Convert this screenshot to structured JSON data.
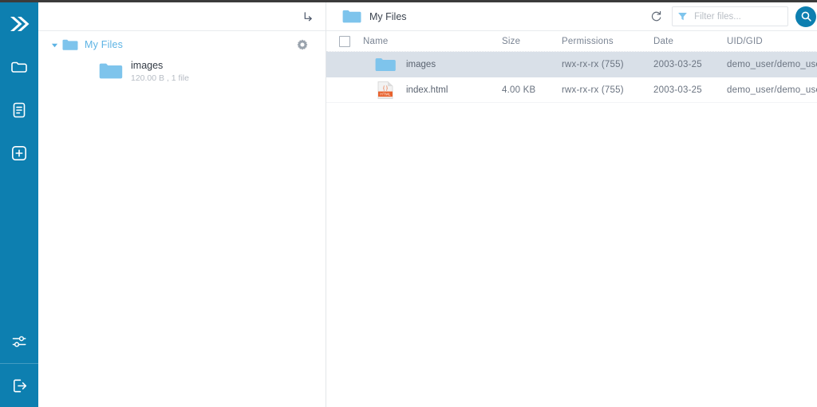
{
  "colors": {
    "sidebar_blue": "#0d7fb0",
    "accent_blue": "#0d7fb0",
    "folder_blue": "#7ec4ec",
    "tree_link": "#5cb3e4",
    "selected_row": "#d9e0e8",
    "html_orange": "#e8622d"
  },
  "sidebar": {
    "logo": {
      "name": "double-chevron-logo"
    },
    "items": [
      {
        "icon": "folder-icon",
        "label": "Files"
      },
      {
        "icon": "document-icon",
        "label": "Editor"
      },
      {
        "icon": "plus-square-icon",
        "label": "New"
      }
    ],
    "bottom_items": [
      {
        "icon": "settings-sliders-icon",
        "label": "Settings"
      },
      {
        "icon": "logout-icon",
        "label": "Log out"
      }
    ]
  },
  "tree_panel": {
    "goto_icon": "enter-arrow-icon",
    "root": {
      "label": "My Files",
      "caret": "caret-down-icon",
      "folder_icon": "folder-icon",
      "gear_icon": "gear-icon"
    },
    "children": [
      {
        "name": "images",
        "meta": "120.00 B , 1 file",
        "folder_icon": "folder-icon"
      }
    ]
  },
  "main": {
    "header": {
      "folder_icon": "folder-icon",
      "title": "My Files",
      "refresh_icon": "refresh-icon",
      "filter": {
        "funnel_icon": "filter-funnel-icon",
        "value": "",
        "placeholder": "Filter files..."
      },
      "search_button": {
        "icon": "search-icon",
        "label": "Search"
      }
    },
    "table": {
      "columns": [
        {
          "key": "check",
          "label": ""
        },
        {
          "key": "name",
          "label": "Name"
        },
        {
          "key": "size",
          "label": "Size"
        },
        {
          "key": "permissions",
          "label": "Permissions"
        },
        {
          "key": "date",
          "label": "Date"
        },
        {
          "key": "uidgid",
          "label": "UID/GID"
        }
      ],
      "select_all_checked": false,
      "rows": [
        {
          "icon": "folder-icon",
          "name": "images",
          "size": "",
          "permissions": "rwx-rx-rx (755)",
          "date": "2003-03-25",
          "uidgid": "demo_user/demo_user",
          "selected": true
        },
        {
          "icon": "html-file-icon",
          "name": "index.html",
          "size": "4.00 KB",
          "permissions": "rwx-rx-rx (755)",
          "date": "2003-03-25",
          "uidgid": "demo_user/demo_user",
          "selected": false
        }
      ]
    }
  }
}
